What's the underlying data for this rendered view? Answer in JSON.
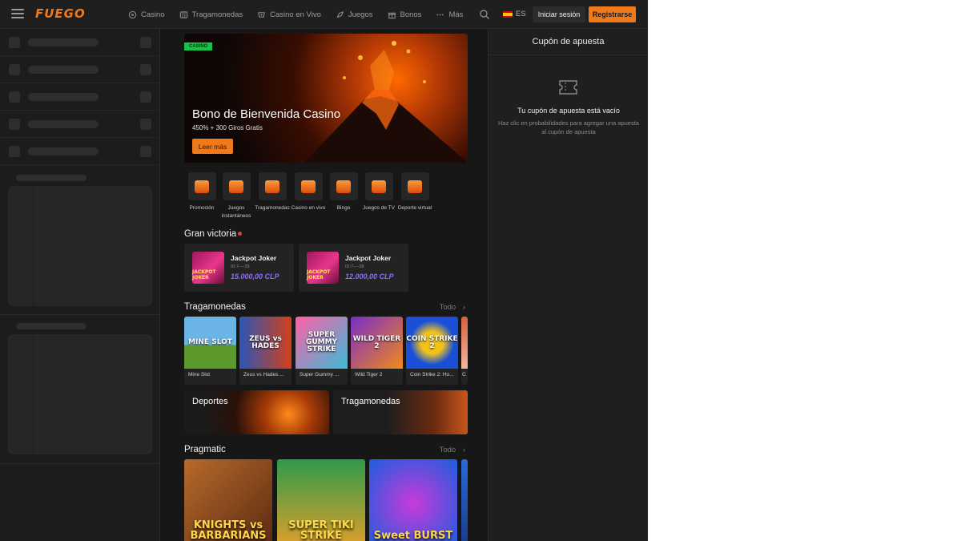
{
  "header": {
    "logo": "FUEGO",
    "nav": [
      {
        "label": "Casino",
        "icon": "casino-chip-icon"
      },
      {
        "label": "Tragamonedas",
        "icon": "slot-machine-icon"
      },
      {
        "label": "Casino en Vivo",
        "icon": "live-casino-icon"
      },
      {
        "label": "Juegos",
        "icon": "rocket-icon"
      },
      {
        "label": "Bonos",
        "icon": "gift-icon"
      },
      {
        "label": "Más",
        "icon": "more-dots-icon"
      }
    ],
    "language": "ES",
    "login_label": "Iniciar sesión",
    "register_label": "Registrarse"
  },
  "banner": {
    "tag": "CASINO",
    "title": "Bono de Bienvenida Casino",
    "subtitle": "450% + 300 Giros Gratis",
    "button": "Leer más"
  },
  "categories": [
    {
      "label": "Promoción"
    },
    {
      "label": "Juegos instantáneos"
    },
    {
      "label": "Tragamonedas"
    },
    {
      "label": "Casino en vivo"
    },
    {
      "label": "Bingo"
    },
    {
      "label": "Juegos de TV"
    },
    {
      "label": "Deporte virtual"
    }
  ],
  "big_win": {
    "title": "Gran victoria",
    "cards": [
      {
        "game": "Jackpot Joker",
        "id": "ID:7----39",
        "amount": "15.000,00 CLP",
        "thumb_text": "JACKPOT JOKER"
      },
      {
        "game": "Jackpot Joker",
        "id": "ID:7----38",
        "amount": "12.000,00 CLP",
        "thumb_text": "JACKPOT JOKER"
      }
    ]
  },
  "slots": {
    "title": "Tragamonedas",
    "see_all": "Todo",
    "games": [
      {
        "name": "Mine Slot",
        "art": "MINE SLOT",
        "color_a": "#6bb4e8",
        "color_b": "#5c9a2e"
      },
      {
        "name": "Zeus vs Hades ...",
        "art": "ZEUS vs HADES",
        "color_a": "#2a56b8",
        "color_b": "#d4401a"
      },
      {
        "name": "Super Gummy ...",
        "art": "SUPER GUMMY STRIKE",
        "color_a": "#ff5fa5",
        "color_b": "#3bbcd8"
      },
      {
        "name": "Wild Tiger 2",
        "art": "WILD TIGER 2",
        "color_a": "#7a2cc8",
        "color_b": "#f08a1a"
      },
      {
        "name": "Coin Strike 2: Ho...",
        "art": "COIN STRIKE 2",
        "color_a": "#1a4fd8",
        "color_b": "#f2c21a"
      },
      {
        "name": "C",
        "art": "",
        "color_a": "#d8603a",
        "color_b": "#f0b8a0"
      }
    ]
  },
  "promos": [
    {
      "label": "Deportes"
    },
    {
      "label": "Tragamonedas"
    }
  ],
  "pragmatic": {
    "title": "Pragmatic",
    "see_all": "Todo",
    "games": [
      {
        "art": "KNIGHTS vs BARBARIANS",
        "color_a": "#b86a2a",
        "color_b": "#5a2a12"
      },
      {
        "art": "SUPER TIKI STRIKE",
        "color_a": "#2e9a4a",
        "color_b": "#e0a02a"
      },
      {
        "art": "Sweet BURST",
        "color_a": "#c83ad8",
        "color_b": "#1a5ee0"
      },
      {
        "art": "",
        "color_a": "#2a6ad8",
        "color_b": "#1a3a8a"
      }
    ]
  },
  "betslip": {
    "title": "Cupón de apuesta",
    "empty_title": "Tu cupón de apuesta está vacío",
    "empty_hint": "Haz clic en probabilidades para agregar una apuesta al cupón de apuesta"
  },
  "colors": {
    "accent": "#f07a1a",
    "tag_green": "#17c34a",
    "amount_purple": "#8f6cff",
    "live_red": "#e53945"
  }
}
